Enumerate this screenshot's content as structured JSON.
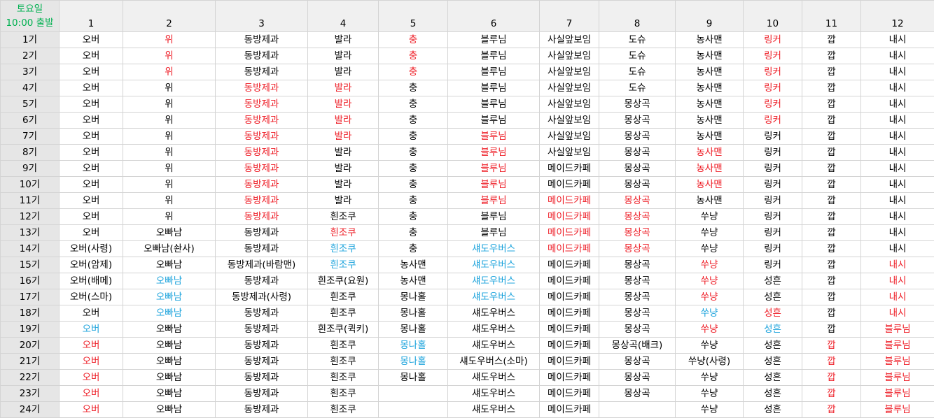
{
  "corner": {
    "line1": "토요일",
    "line2": "10:00 출발"
  },
  "colors": {
    "red": "#ee1c25",
    "blue": "#1ca3dc",
    "green": "#00b050"
  },
  "columns": [
    "1",
    "2",
    "3",
    "4",
    "5",
    "6",
    "7",
    "8",
    "9",
    "10",
    "11",
    "12"
  ],
  "rows": [
    {
      "label": "1기",
      "cells": [
        [
          "오버",
          "k"
        ],
        [
          "위",
          "r"
        ],
        [
          "동방제과",
          "k"
        ],
        [
          "발라",
          "k"
        ],
        [
          "충",
          "r"
        ],
        [
          "블루님",
          "k"
        ],
        [
          "사실앞보임",
          "k"
        ],
        [
          "도슈",
          "k"
        ],
        [
          "농사맨",
          "k"
        ],
        [
          "링커",
          "r"
        ],
        [
          "깝",
          "k"
        ],
        [
          "내시",
          "k"
        ]
      ]
    },
    {
      "label": "2기",
      "cells": [
        [
          "오버",
          "k"
        ],
        [
          "위",
          "r"
        ],
        [
          "동방제과",
          "k"
        ],
        [
          "발라",
          "k"
        ],
        [
          "충",
          "r"
        ],
        [
          "블루님",
          "k"
        ],
        [
          "사실앞보임",
          "k"
        ],
        [
          "도슈",
          "k"
        ],
        [
          "농사맨",
          "k"
        ],
        [
          "링커",
          "r"
        ],
        [
          "깝",
          "k"
        ],
        [
          "내시",
          "k"
        ]
      ]
    },
    {
      "label": "3기",
      "cells": [
        [
          "오버",
          "k"
        ],
        [
          "위",
          "r"
        ],
        [
          "동방제과",
          "k"
        ],
        [
          "발라",
          "k"
        ],
        [
          "충",
          "r"
        ],
        [
          "블루님",
          "k"
        ],
        [
          "사실앞보임",
          "k"
        ],
        [
          "도슈",
          "k"
        ],
        [
          "농사맨",
          "k"
        ],
        [
          "링커",
          "r"
        ],
        [
          "깝",
          "k"
        ],
        [
          "내시",
          "k"
        ]
      ]
    },
    {
      "label": "4기",
      "cells": [
        [
          "오버",
          "k"
        ],
        [
          "위",
          "k"
        ],
        [
          "동방제과",
          "r"
        ],
        [
          "발라",
          "r"
        ],
        [
          "충",
          "k"
        ],
        [
          "블루님",
          "k"
        ],
        [
          "사실앞보임",
          "k"
        ],
        [
          "도슈",
          "k"
        ],
        [
          "농사맨",
          "k"
        ],
        [
          "링커",
          "r"
        ],
        [
          "깝",
          "k"
        ],
        [
          "내시",
          "k"
        ]
      ]
    },
    {
      "label": "5기",
      "cells": [
        [
          "오버",
          "k"
        ],
        [
          "위",
          "k"
        ],
        [
          "동방제과",
          "r"
        ],
        [
          "발라",
          "r"
        ],
        [
          "충",
          "k"
        ],
        [
          "블루님",
          "k"
        ],
        [
          "사실앞보임",
          "k"
        ],
        [
          "몽상곡",
          "k"
        ],
        [
          "농사맨",
          "k"
        ],
        [
          "링커",
          "r"
        ],
        [
          "깝",
          "k"
        ],
        [
          "내시",
          "k"
        ]
      ]
    },
    {
      "label": "6기",
      "cells": [
        [
          "오버",
          "k"
        ],
        [
          "위",
          "k"
        ],
        [
          "동방제과",
          "r"
        ],
        [
          "발라",
          "r"
        ],
        [
          "충",
          "k"
        ],
        [
          "블루님",
          "k"
        ],
        [
          "사실앞보임",
          "k"
        ],
        [
          "몽상곡",
          "k"
        ],
        [
          "농사맨",
          "k"
        ],
        [
          "링커",
          "r"
        ],
        [
          "깝",
          "k"
        ],
        [
          "내시",
          "k"
        ]
      ]
    },
    {
      "label": "7기",
      "cells": [
        [
          "오버",
          "k"
        ],
        [
          "위",
          "k"
        ],
        [
          "동방제과",
          "r"
        ],
        [
          "발라",
          "r"
        ],
        [
          "충",
          "k"
        ],
        [
          "블루님",
          "r"
        ],
        [
          "사실앞보임",
          "k"
        ],
        [
          "몽상곡",
          "k"
        ],
        [
          "농사맨",
          "k"
        ],
        [
          "링커",
          "k"
        ],
        [
          "깝",
          "k"
        ],
        [
          "내시",
          "k"
        ]
      ]
    },
    {
      "label": "8기",
      "cells": [
        [
          "오버",
          "k"
        ],
        [
          "위",
          "k"
        ],
        [
          "동방제과",
          "r"
        ],
        [
          "발라",
          "k"
        ],
        [
          "충",
          "k"
        ],
        [
          "블루님",
          "r"
        ],
        [
          "사실앞보임",
          "k"
        ],
        [
          "몽상곡",
          "k"
        ],
        [
          "농사맨",
          "r"
        ],
        [
          "링커",
          "k"
        ],
        [
          "깝",
          "k"
        ],
        [
          "내시",
          "k"
        ]
      ]
    },
    {
      "label": "9기",
      "cells": [
        [
          "오버",
          "k"
        ],
        [
          "위",
          "k"
        ],
        [
          "동방제과",
          "r"
        ],
        [
          "발라",
          "k"
        ],
        [
          "충",
          "k"
        ],
        [
          "블루님",
          "r"
        ],
        [
          "메이드카페",
          "k"
        ],
        [
          "몽상곡",
          "k"
        ],
        [
          "농사맨",
          "r"
        ],
        [
          "링커",
          "k"
        ],
        [
          "깝",
          "k"
        ],
        [
          "내시",
          "k"
        ]
      ]
    },
    {
      "label": "10기",
      "cells": [
        [
          "오버",
          "k"
        ],
        [
          "위",
          "k"
        ],
        [
          "동방제과",
          "r"
        ],
        [
          "발라",
          "k"
        ],
        [
          "충",
          "k"
        ],
        [
          "블루님",
          "r"
        ],
        [
          "메이드카페",
          "k"
        ],
        [
          "몽상곡",
          "k"
        ],
        [
          "농사맨",
          "r"
        ],
        [
          "링커",
          "k"
        ],
        [
          "깝",
          "k"
        ],
        [
          "내시",
          "k"
        ]
      ]
    },
    {
      "label": "11기",
      "cells": [
        [
          "오버",
          "k"
        ],
        [
          "위",
          "k"
        ],
        [
          "동방제과",
          "r"
        ],
        [
          "발라",
          "k"
        ],
        [
          "충",
          "k"
        ],
        [
          "블루님",
          "r"
        ],
        [
          "메이드카페",
          "r"
        ],
        [
          "몽상곡",
          "r"
        ],
        [
          "농사맨",
          "k"
        ],
        [
          "링커",
          "k"
        ],
        [
          "깝",
          "k"
        ],
        [
          "내시",
          "k"
        ]
      ]
    },
    {
      "label": "12기",
      "cells": [
        [
          "오버",
          "k"
        ],
        [
          "위",
          "k"
        ],
        [
          "동방제과",
          "r"
        ],
        [
          "흰조쿠",
          "k"
        ],
        [
          "충",
          "k"
        ],
        [
          "블루님",
          "k"
        ],
        [
          "메이드카페",
          "r"
        ],
        [
          "몽상곡",
          "r"
        ],
        [
          "쑤냥",
          "k"
        ],
        [
          "링커",
          "k"
        ],
        [
          "깝",
          "k"
        ],
        [
          "내시",
          "k"
        ]
      ]
    },
    {
      "label": "13기",
      "cells": [
        [
          "오버",
          "k"
        ],
        [
          "오빠남",
          "k"
        ],
        [
          "동방제과",
          "k"
        ],
        [
          "흰조쿠",
          "r"
        ],
        [
          "충",
          "k"
        ],
        [
          "블루님",
          "k"
        ],
        [
          "메이드카페",
          "r"
        ],
        [
          "몽상곡",
          "r"
        ],
        [
          "쑤냥",
          "k"
        ],
        [
          "링커",
          "k"
        ],
        [
          "깝",
          "k"
        ],
        [
          "내시",
          "k"
        ]
      ]
    },
    {
      "label": "14기",
      "cells": [
        [
          "오버(사령)",
          "k"
        ],
        [
          "오빠남(솬사)",
          "k"
        ],
        [
          "동방제과",
          "k"
        ],
        [
          "흰조쿠",
          "b"
        ],
        [
          "충",
          "k"
        ],
        [
          "섀도우버스",
          "b"
        ],
        [
          "메이드카페",
          "r"
        ],
        [
          "몽상곡",
          "r"
        ],
        [
          "쑤냥",
          "k"
        ],
        [
          "링커",
          "k"
        ],
        [
          "깝",
          "k"
        ],
        [
          "내시",
          "k"
        ]
      ]
    },
    {
      "label": "15기",
      "cells": [
        [
          "오버(암제)",
          "k"
        ],
        [
          "오빠남",
          "k"
        ],
        [
          "동방제과(바람맨)",
          "k"
        ],
        [
          "흰조쿠",
          "b"
        ],
        [
          "농사맨",
          "k"
        ],
        [
          "섀도우버스",
          "b"
        ],
        [
          "메이드카페",
          "k"
        ],
        [
          "몽상곡",
          "k"
        ],
        [
          "쑤냥",
          "r"
        ],
        [
          "링커",
          "k"
        ],
        [
          "깝",
          "k"
        ],
        [
          "내시",
          "r"
        ]
      ]
    },
    {
      "label": "16기",
      "cells": [
        [
          "오버(배메)",
          "k"
        ],
        [
          "오빠남",
          "b"
        ],
        [
          "동방제과",
          "k"
        ],
        [
          "흰조쿠(요원)",
          "k"
        ],
        [
          "농사맨",
          "k"
        ],
        [
          "섀도우버스",
          "b"
        ],
        [
          "메이드카페",
          "k"
        ],
        [
          "몽상곡",
          "k"
        ],
        [
          "쑤냥",
          "r"
        ],
        [
          "성흔",
          "k"
        ],
        [
          "깝",
          "k"
        ],
        [
          "내시",
          "r"
        ]
      ]
    },
    {
      "label": "17기",
      "cells": [
        [
          "오버(스마)",
          "k"
        ],
        [
          "오빠남",
          "b"
        ],
        [
          "동방제과(사령)",
          "k"
        ],
        [
          "흰조쿠",
          "k"
        ],
        [
          "몽나홀",
          "k"
        ],
        [
          "섀도우버스",
          "b"
        ],
        [
          "메이드카페",
          "k"
        ],
        [
          "몽상곡",
          "k"
        ],
        [
          "쑤냥",
          "r"
        ],
        [
          "성흔",
          "k"
        ],
        [
          "깝",
          "k"
        ],
        [
          "내시",
          "r"
        ]
      ]
    },
    {
      "label": "18기",
      "cells": [
        [
          "오버",
          "k"
        ],
        [
          "오빠남",
          "b"
        ],
        [
          "동방제과",
          "k"
        ],
        [
          "흰조쿠",
          "k"
        ],
        [
          "몽나홀",
          "k"
        ],
        [
          "섀도우버스",
          "k"
        ],
        [
          "메이드카페",
          "k"
        ],
        [
          "몽상곡",
          "k"
        ],
        [
          "쑤냥",
          "b"
        ],
        [
          "성흔",
          "r"
        ],
        [
          "깝",
          "k"
        ],
        [
          "내시",
          "r"
        ]
      ]
    },
    {
      "label": "19기",
      "cells": [
        [
          "오버",
          "b"
        ],
        [
          "오빠남",
          "k"
        ],
        [
          "동방제과",
          "k"
        ],
        [
          "흰조쿠(퀵키)",
          "k"
        ],
        [
          "몽나홀",
          "k"
        ],
        [
          "섀도우버스",
          "k"
        ],
        [
          "메이드카페",
          "k"
        ],
        [
          "몽상곡",
          "k"
        ],
        [
          "쑤냥",
          "r"
        ],
        [
          "성흔",
          "b"
        ],
        [
          "깝",
          "k"
        ],
        [
          "블루님",
          "r"
        ]
      ]
    },
    {
      "label": "20기",
      "cells": [
        [
          "오버",
          "r"
        ],
        [
          "오빠남",
          "k"
        ],
        [
          "동방제과",
          "k"
        ],
        [
          "흰조쿠",
          "k"
        ],
        [
          "몽나홀",
          "b"
        ],
        [
          "섀도우버스",
          "k"
        ],
        [
          "메이드카페",
          "k"
        ],
        [
          "몽상곡(배크)",
          "k"
        ],
        [
          "쑤냥",
          "k"
        ],
        [
          "성흔",
          "k"
        ],
        [
          "깝",
          "r"
        ],
        [
          "블루님",
          "r"
        ]
      ]
    },
    {
      "label": "21기",
      "cells": [
        [
          "오버",
          "r"
        ],
        [
          "오빠남",
          "k"
        ],
        [
          "동방제과",
          "k"
        ],
        [
          "흰조쿠",
          "k"
        ],
        [
          "몽나홀",
          "b"
        ],
        [
          "섀도우버스(소마)",
          "k"
        ],
        [
          "메이드카페",
          "k"
        ],
        [
          "몽상곡",
          "k"
        ],
        [
          "쑤냥(사령)",
          "k"
        ],
        [
          "성흔",
          "k"
        ],
        [
          "깝",
          "r"
        ],
        [
          "블루님",
          "r"
        ]
      ]
    },
    {
      "label": "22기",
      "cells": [
        [
          "오버",
          "r"
        ],
        [
          "오빠남",
          "k"
        ],
        [
          "동방제과",
          "k"
        ],
        [
          "흰조쿠",
          "k"
        ],
        [
          "몽나홀",
          "k"
        ],
        [
          "섀도우버스",
          "k"
        ],
        [
          "메이드카페",
          "k"
        ],
        [
          "몽상곡",
          "k"
        ],
        [
          "쑤냥",
          "k"
        ],
        [
          "성흔",
          "k"
        ],
        [
          "깝",
          "r"
        ],
        [
          "블루님",
          "r"
        ]
      ]
    },
    {
      "label": "23기",
      "cells": [
        [
          "오버",
          "r"
        ],
        [
          "오빠남",
          "k"
        ],
        [
          "동방제과",
          "k"
        ],
        [
          "흰조쿠",
          "k"
        ],
        [
          "",
          "k"
        ],
        [
          "섀도우버스",
          "k"
        ],
        [
          "메이드카페",
          "k"
        ],
        [
          "몽상곡",
          "k"
        ],
        [
          "쑤냥",
          "k"
        ],
        [
          "성흔",
          "k"
        ],
        [
          "깝",
          "r"
        ],
        [
          "블루님",
          "r"
        ]
      ]
    },
    {
      "label": "24기",
      "cells": [
        [
          "오버",
          "r"
        ],
        [
          "오빠남",
          "k"
        ],
        [
          "동방제과",
          "k"
        ],
        [
          "흰조쿠",
          "k"
        ],
        [
          "",
          "k"
        ],
        [
          "섀도우버스",
          "k"
        ],
        [
          "메이드카페",
          "k"
        ],
        [
          "",
          "k"
        ],
        [
          "쑤냥",
          "k"
        ],
        [
          "성흔",
          "k"
        ],
        [
          "깝",
          "r"
        ],
        [
          "블루님",
          "r"
        ]
      ]
    }
  ]
}
